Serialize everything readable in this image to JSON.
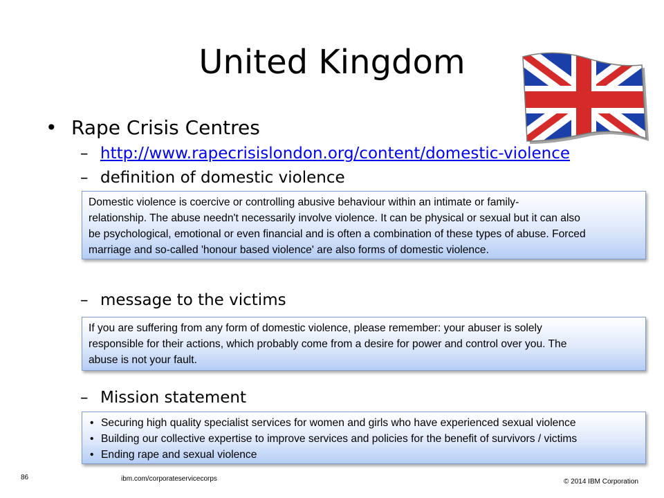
{
  "slide": {
    "title": "United Kingdom",
    "bullet": "Rape Crisis Centres",
    "sub_items": {
      "link": "http://www.rapecrisislondon.org/content/domestic-violence",
      "definition_heading": "definition of domestic violence",
      "message_heading": "message to the victims",
      "mission_heading": "Mission statement"
    },
    "boxes": {
      "definition_lines": [
        "Domestic violence is coercive or controlling abusive behaviour within an intimate or family-",
        "relationship.  The abuse needn't necessarily involve violence. It can be physical or sexual but it can also",
        "be psychological, emotional or even financial and is often a combination of these types of abuse. Forced",
        "marriage and so-called 'honour based violence' are also forms of domestic violence."
      ],
      "message_lines": [
        "If you are suffering from any form of domestic violence, please remember:  your abuser is solely",
        "responsible for their actions, which probably come from a desire for power and control over you. The",
        "abuse is not your fault."
      ],
      "mission_items": [
        "Securing high quality specialist services for women and girls who have experienced sexual violence",
        "Building our collective expertise to improve services and policies for the benefit of survivors / victims",
        "Ending rape and sexual violence"
      ]
    },
    "footer": {
      "page_number": "86",
      "website": "ibm.com/corporateservicecorps",
      "copyright": "© 2014 IBM Corporation"
    },
    "icons": {
      "bullet": "bullet-dot",
      "flag": "union-jack-flag-icon"
    },
    "colors": {
      "link": "#0000ee",
      "box_border": "#7f9ccb",
      "flag_blue": "#1a3fa8",
      "flag_red": "#d42a2a"
    }
  }
}
